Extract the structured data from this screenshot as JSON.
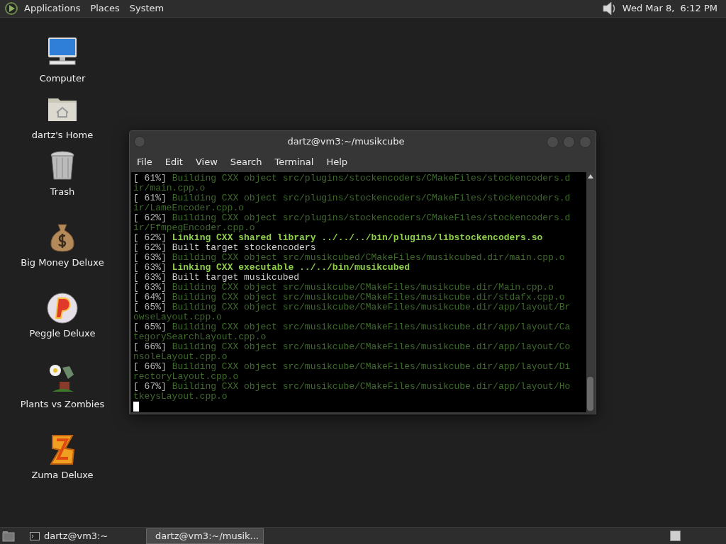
{
  "top_panel": {
    "menus": [
      "Applications",
      "Places",
      "System"
    ],
    "clock": "Wed Mar 8,  6:12 PM"
  },
  "desktop_icons": [
    {
      "label": "Computer",
      "kind": "computer"
    },
    {
      "label": "dartz's Home",
      "kind": "home"
    },
    {
      "label": "Trash",
      "kind": "trash"
    },
    {
      "label": "Big Money Deluxe",
      "kind": "moneybag"
    },
    {
      "label": "Peggle Deluxe",
      "kind": "peggle"
    },
    {
      "label": "Plants vs Zombies",
      "kind": "plant"
    },
    {
      "label": "Zuma Deluxe",
      "kind": "zuma"
    }
  ],
  "terminal": {
    "title": "dartz@vm3:~/musikcube",
    "menu": [
      "File",
      "Edit",
      "View",
      "Search",
      "Terminal",
      "Help"
    ],
    "lines": [
      {
        "progress": "[ 61%]",
        "text": "Building CXX object src/plugins/stockencoders/CMakeFiles/stockencoders.dir/main.cpp.o",
        "kind": "dim"
      },
      {
        "progress": "[ 61%]",
        "text": "Building CXX object src/plugins/stockencoders/CMakeFiles/stockencoders.dir/LameEncoder.cpp.o",
        "kind": "dim"
      },
      {
        "progress": "[ 62%]",
        "text": "Building CXX object src/plugins/stockencoders/CMakeFiles/stockencoders.dir/FfmpegEncoder.cpp.o",
        "kind": "dim"
      },
      {
        "progress": "[ 62%]",
        "text": "Linking CXX shared library ../../../bin/plugins/libstockencoders.so",
        "kind": "bold"
      },
      {
        "progress": "[ 62%]",
        "text": "Built target stockencoders",
        "kind": "normal"
      },
      {
        "progress": "[ 63%]",
        "text": "Building CXX object src/musikcubed/CMakeFiles/musikcubed.dir/main.cpp.o",
        "kind": "dim"
      },
      {
        "progress": "[ 63%]",
        "text": "Linking CXX executable ../../bin/musikcubed",
        "kind": "bold"
      },
      {
        "progress": "[ 63%]",
        "text": "Built target musikcubed",
        "kind": "normal"
      },
      {
        "progress": "[ 63%]",
        "text": "Building CXX object src/musikcube/CMakeFiles/musikcube.dir/Main.cpp.o",
        "kind": "dim"
      },
      {
        "progress": "[ 64%]",
        "text": "Building CXX object src/musikcube/CMakeFiles/musikcube.dir/stdafx.cpp.o",
        "kind": "dim"
      },
      {
        "progress": "[ 65%]",
        "text": "Building CXX object src/musikcube/CMakeFiles/musikcube.dir/app/layout/BrowseLayout.cpp.o",
        "kind": "dim"
      },
      {
        "progress": "[ 65%]",
        "text": "Building CXX object src/musikcube/CMakeFiles/musikcube.dir/app/layout/CategorySearchLayout.cpp.o",
        "kind": "dim"
      },
      {
        "progress": "[ 66%]",
        "text": "Building CXX object src/musikcube/CMakeFiles/musikcube.dir/app/layout/ConsoleLayout.cpp.o",
        "kind": "dim"
      },
      {
        "progress": "[ 66%]",
        "text": "Building CXX object src/musikcube/CMakeFiles/musikcube.dir/app/layout/DirectoryLayout.cpp.o",
        "kind": "dim"
      },
      {
        "progress": "[ 67%]",
        "text": "Building CXX object src/musikcube/CMakeFiles/musikcube.dir/app/layout/HotkeysLayout.cpp.o",
        "kind": "dim"
      }
    ]
  },
  "taskbar": {
    "tasks": [
      {
        "label": "dartz@vm3:~",
        "selected": false
      },
      {
        "label": "dartz@vm3:~/musik...",
        "selected": true
      }
    ]
  }
}
